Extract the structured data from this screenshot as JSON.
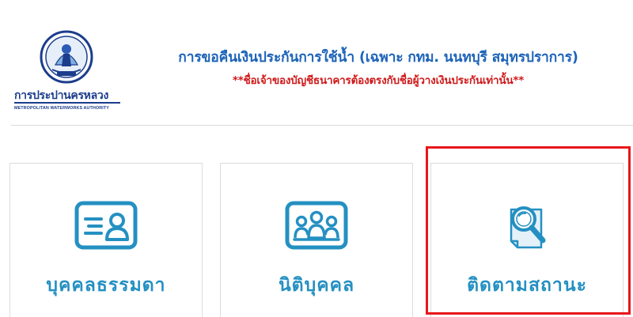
{
  "header": {
    "logo": {
      "org_name_th": "การประปานครหลวง",
      "org_name_en": "METROPOLITAN WATERWORKS AUTHORITY"
    },
    "title": "การขอคืนเงินประกันการใช้น้ำ (เฉพาะ กทม. นนทบุรี สมุทรปราการ)",
    "warning": "**ชื่อเจ้าของบัญชีธนาคารต้องตรงกับชื่อผู้วางเงินประกันเท่านั้น**"
  },
  "cards": [
    {
      "label": "บุคคลธรรมดา",
      "icon": "id-card-icon"
    },
    {
      "label": "นิติบุคคล",
      "icon": "group-people-icon"
    },
    {
      "label": "ติดตามสถานะ",
      "icon": "search-document-icon"
    }
  ],
  "colors": {
    "title_blue": "#1d63b8",
    "warning_red": "#d0191a",
    "icon_blue": "#2490c2",
    "highlight_red": "#e8161c"
  }
}
